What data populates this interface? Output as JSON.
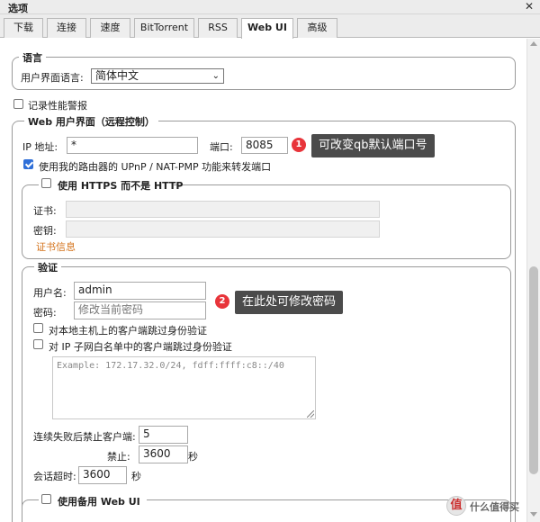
{
  "window": {
    "title": "选项",
    "close": "✕"
  },
  "tabs": [
    "下载",
    "连接",
    "速度",
    "BitTorrent",
    "RSS",
    "Web UI",
    "高级"
  ],
  "active_tab": "Web UI",
  "language": {
    "legend": "语言",
    "label": "用户界面语言:",
    "value": "简体中文"
  },
  "perf_warning": {
    "label": "记录性能警报",
    "checked": false
  },
  "webui": {
    "legend": "Web 用户界面（远程控制）",
    "ip_label": "IP 地址:",
    "ip_value": "*",
    "port_label": "端口:",
    "port_value": "8085",
    "upnp_label": "使用我的路由器的 UPnP / NAT-PMP 功能来转发端口",
    "upnp_checked": true
  },
  "https": {
    "legend": "使用 HTTPS 而不是 HTTP",
    "checked": false,
    "cert_label": "证书:",
    "key_label": "密钥:",
    "cert_info_link": "证书信息"
  },
  "auth": {
    "legend": "验证",
    "username_label": "用户名:",
    "username_value": "admin",
    "password_label": "密码:",
    "password_placeholder": "修改当前密码",
    "bypass_local_label": "对本地主机上的客户端跳过身份验证",
    "bypass_local_checked": false,
    "bypass_whitelist_label": "对 IP 子网白名单中的客户端跳过身份验证",
    "bypass_whitelist_checked": false,
    "whitelist_placeholder": "Example: 172.17.32.0/24, fdff:ffff:c8::/40",
    "ban_after_label": "连续失败后禁止客户端:",
    "ban_after_value": "5",
    "ban_for_label": "禁止:",
    "ban_for_value": "3600",
    "ban_for_unit": "秒",
    "session_timeout_label": "会话超时:",
    "session_timeout_value": "3600",
    "session_timeout_unit": "秒"
  },
  "alt_webui": {
    "legend": "使用备用 Web UI"
  },
  "annotations": [
    {
      "number": "1",
      "text": "可改变qb默认端口号"
    },
    {
      "number": "2",
      "text": "在此处可修改密码"
    }
  ],
  "watermark": {
    "logo": "值",
    "text": "什么值得买"
  },
  "colors": {
    "badge": "#e8343a",
    "callout_bg": "#4b4b4b",
    "link": "#d4731b",
    "checkbox_checked": "#2f6fd8"
  }
}
